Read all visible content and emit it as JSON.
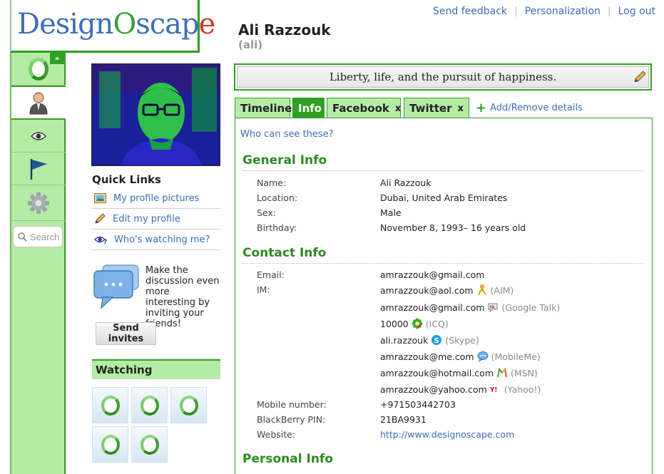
{
  "brand": {
    "logo_text_1": "Design",
    "logo_text_2": "O",
    "logo_text_3": "scap",
    "logo_text_4": "e"
  },
  "rail": {
    "expand_glyph": "»",
    "search_placeholder": "Search"
  },
  "header": {
    "links": [
      "Send feedback",
      "Personalization",
      "Log out"
    ],
    "name": "Ali Razzouk",
    "username": "(ali)"
  },
  "quick_links": {
    "title": "Quick Links",
    "items": [
      "My profile pictures",
      "Edit my profile",
      "Who's watching me?"
    ]
  },
  "invite": {
    "text": "Make the discussion even more interesting by inviting your friends!",
    "button": "Send invites"
  },
  "watching": {
    "title": "Watching"
  },
  "motto": "Liberty, life, and the pursuit of happiness.",
  "tabs": [
    {
      "label": "Timeline"
    },
    {
      "label": "Info"
    },
    {
      "label": "Facebook",
      "close": "x"
    },
    {
      "label": "Twitter",
      "close": "x"
    }
  ],
  "add_remove": "Add/Remove details",
  "who_can_see": "Who can see these?",
  "general": {
    "title": "General Info",
    "rows": [
      {
        "label": "Name:",
        "value": "Ali Razzouk"
      },
      {
        "label": "Location:",
        "value": "Dubai, United Arab Emirates"
      },
      {
        "label": "Sex:",
        "value": "Male"
      },
      {
        "label": "Birthday:",
        "value": "November 8, 1993– 16 years old"
      }
    ]
  },
  "contact": {
    "title": "Contact Info",
    "email_label": "Email:",
    "email": "amrazzouk@gmail.com",
    "im_label": "IM:",
    "im": [
      {
        "handle": "amrazzouk@aol.com",
        "service": "(AIM)"
      },
      {
        "handle": "amrazzouk@gmail.com",
        "service": "(Google Talk)"
      },
      {
        "handle": "10000",
        "service": "(ICQ)"
      },
      {
        "handle": "ali.razzouk",
        "service": "(Skype)"
      },
      {
        "handle": "amrazzouk@me.com",
        "service": "(MobileMe)"
      },
      {
        "handle": "amrazzouk@hotmail.com",
        "service": "(MSN)"
      },
      {
        "handle": "amrazzouk@yahoo.com",
        "service": "(Yahoo!)"
      }
    ],
    "mobile_label": "Mobile number:",
    "mobile": "+971503442703",
    "bb_label": "BlackBerry PIN:",
    "bb": "21BA9931",
    "website_label": "Website:",
    "website": "http://www.designoscape.com"
  },
  "personal": {
    "title": "Personal Info"
  }
}
